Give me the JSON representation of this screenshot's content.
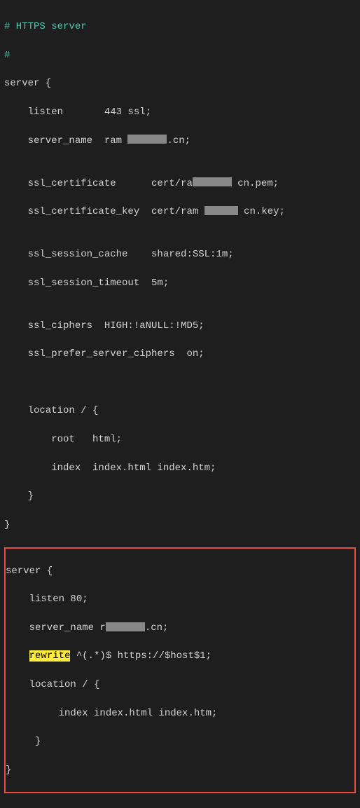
{
  "lines": {
    "l1": "# HTTPS server",
    "l2": "#",
    "l3": "server {",
    "l4a": "    listen       443 ssl;",
    "l5a": "    server_name  ram",
    "l5b": ".cn;",
    "l6": "",
    "l7a": "    ssl_certificate      cert/ra",
    "l7b": " cn.pem;",
    "l8a": "    ssl_certificate_key  cert/ram",
    "l8b": " cn.key;",
    "l9": "",
    "l10": "    ssl_session_cache    shared:SSL:1m;",
    "l11": "    ssl_session_timeout  5m;",
    "l12": "",
    "l13": "    ssl_ciphers  HIGH:!aNULL:!MD5;",
    "l14": "    ssl_prefer_server_ciphers  on;",
    "l15": "",
    "l16": "",
    "l17": "    location / {",
    "l18": "        root   html;",
    "l19": "        index  index.html index.htm;",
    "l20": "    }",
    "l21": "}",
    "h1": "server {",
    "h2": "    listen 80;",
    "h3a": "    server_name r",
    "h3b": ".cn;",
    "h4a": "    ",
    "h4b": "rewrite",
    "h4c": " ^(.*)$ https://$host$1;",
    "h5": "    location / {",
    "h6": "         index index.html index.htm;",
    "h7": "     }",
    "h8": "}"
  }
}
